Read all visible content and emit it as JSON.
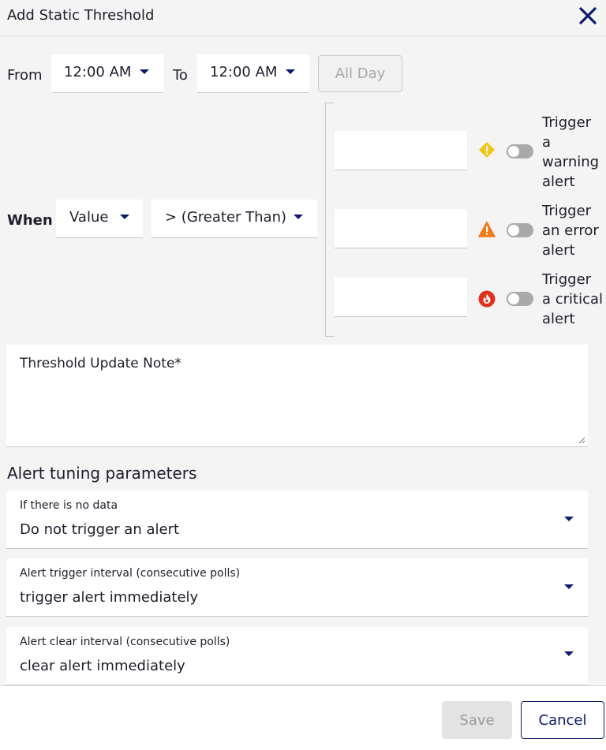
{
  "header": {
    "title": "Add Static Threshold",
    "close_icon": "close-icon"
  },
  "time_range": {
    "from_label": "From",
    "from_value": "12:00 AM",
    "to_label": "To",
    "to_value": "12:00 AM",
    "all_day_label": "All Day"
  },
  "condition": {
    "when_label": "When",
    "metric_value": "Value",
    "operator_value": "> (Greater Than)"
  },
  "thresholds": [
    {
      "severity": "warning",
      "icon": "warning-diamond-icon",
      "color": "#f2c418",
      "toggle_on": false,
      "label_lines": [
        "Trigger",
        "a",
        "warning",
        "alert"
      ]
    },
    {
      "severity": "error",
      "icon": "error-triangle-icon",
      "color": "#f07a16",
      "toggle_on": false,
      "label_lines": [
        "Trigger",
        "an error",
        "alert"
      ]
    },
    {
      "severity": "critical",
      "icon": "critical-flame-icon",
      "color": "#e0301e",
      "toggle_on": false,
      "label_lines": [
        "Trigger",
        "a critical",
        "alert"
      ]
    }
  ],
  "note": {
    "label": "Threshold Update Note*"
  },
  "tuning": {
    "title": "Alert tuning parameters",
    "params": [
      {
        "label": "If there is no data",
        "value": "Do not trigger an alert"
      },
      {
        "label": "Alert trigger interval (consecutive polls)",
        "value": "trigger alert immediately"
      },
      {
        "label": "Alert clear interval (consecutive polls)",
        "value": "clear alert immediately"
      }
    ]
  },
  "footer": {
    "save_label": "Save",
    "cancel_label": "Cancel"
  },
  "colors": {
    "accent": "#0e1a6b",
    "background": "#f4f4f4",
    "toggle_off": "#a9a9a9"
  }
}
